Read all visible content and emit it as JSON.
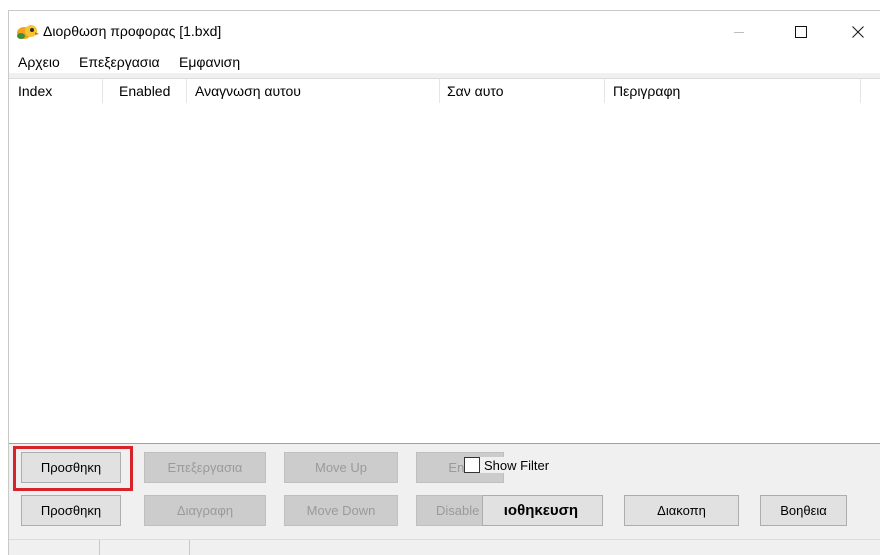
{
  "window": {
    "title": "Διορθωση προφορας [1.bxd]"
  },
  "menu": {
    "items": [
      "Αρχειο",
      "Επεξεργασια",
      "Εμφανιση"
    ]
  },
  "table": {
    "columns": [
      "Index",
      "Enabled",
      "Αναγνωση αυτου",
      "Σαν αυτο",
      "Περιγραφη"
    ],
    "rows": []
  },
  "buttons": {
    "add_top": "Προσθηκη",
    "edit": "Επεξεργασια",
    "move_up": "Move Up",
    "enable": "Ena",
    "add_bottom": "Προσθηκη",
    "delete": "Διαγραφη",
    "move_down": "Move Down",
    "disable": "Disable",
    "save": "ιοθηκευση",
    "cancel": "Διακοπη",
    "help": "Βοηθεια"
  },
  "filter": {
    "label": "Show Filter",
    "checked": false
  },
  "colors": {
    "highlight": "#d8232a",
    "window_bg": "#f0f0f0",
    "disabled_button": "#cccccc"
  }
}
